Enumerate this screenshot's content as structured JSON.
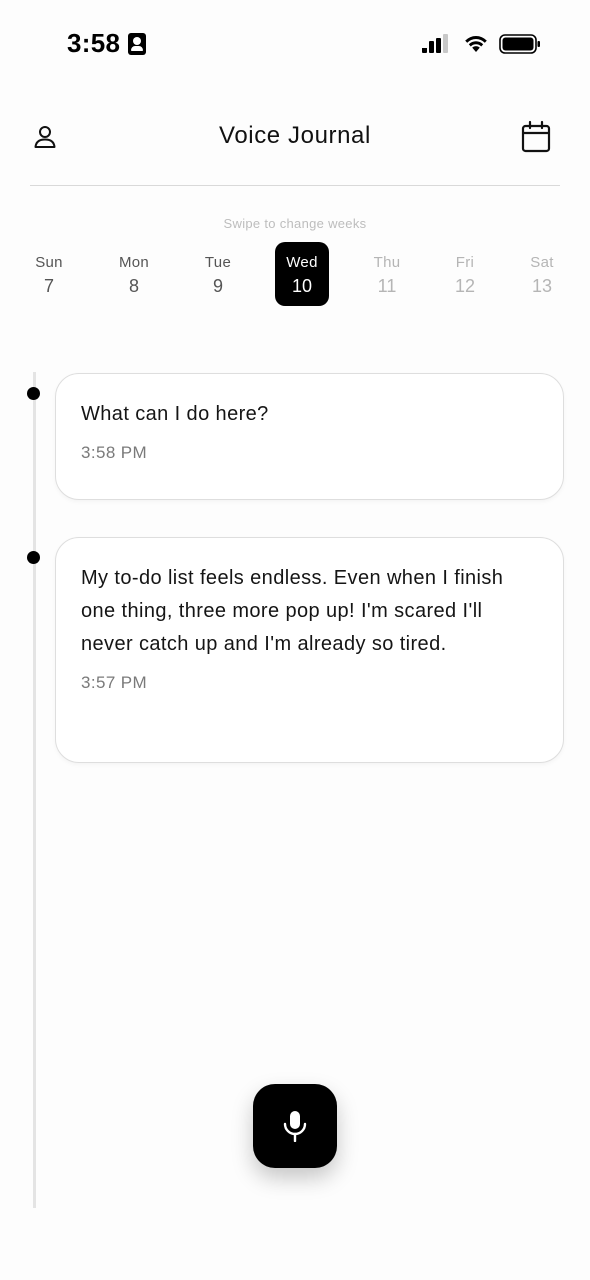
{
  "status_bar": {
    "time": "3:58",
    "icons": [
      "person-badge-icon",
      "cellular-signal-icon",
      "wifi-icon",
      "battery-icon"
    ]
  },
  "header": {
    "title": "Voice Journal",
    "left_icon": "person-icon",
    "right_icon": "calendar-icon"
  },
  "week_picker": {
    "hint": "Swipe to change weeks",
    "days": [
      {
        "name": "Sun",
        "date": "7",
        "state": "past"
      },
      {
        "name": "Mon",
        "date": "8",
        "state": "past"
      },
      {
        "name": "Tue",
        "date": "9",
        "state": "past"
      },
      {
        "name": "Wed",
        "date": "10",
        "state": "selected"
      },
      {
        "name": "Thu",
        "date": "11",
        "state": "future"
      },
      {
        "name": "Fri",
        "date": "12",
        "state": "future"
      },
      {
        "name": "Sat",
        "date": "13",
        "state": "future"
      }
    ]
  },
  "entries": [
    {
      "text": "What can I do here?",
      "time": "3:58 PM"
    },
    {
      "text": "My to-do list feels endless. Even when I finish one thing, three more pop up! I'm scared I'll never catch up and I'm already so tired.",
      "time": "3:57 PM"
    }
  ],
  "record_button": {
    "icon": "microphone-icon"
  },
  "colors": {
    "accent": "#000000",
    "background": "#fdfdfd",
    "muted_text": "#7a7a7a",
    "future_day": "#b5b5b5"
  }
}
